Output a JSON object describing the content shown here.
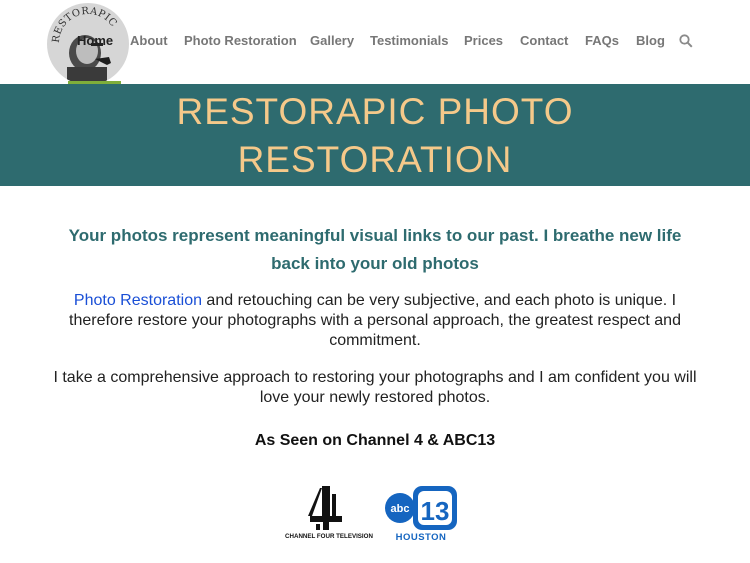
{
  "header": {
    "logo_text": "RESTORAPIC",
    "nav": [
      {
        "label": "Home",
        "active": true
      },
      {
        "label": "About"
      },
      {
        "label": "Photo Restoration"
      },
      {
        "label": "Gallery"
      },
      {
        "label": "Testimonials"
      },
      {
        "label": "Prices"
      },
      {
        "label": "Contact"
      },
      {
        "label": "FAQs"
      },
      {
        "label": "Blog"
      }
    ],
    "search_icon": "search-icon"
  },
  "banner": {
    "title_line1": "RESTORAPIC PHOTO",
    "title_line2": "RESTORATION"
  },
  "content": {
    "tagline_line1": "Your photos represent meaningful visual links to our past. I breathe new life",
    "tagline_line2": "back into your old photos",
    "para1_link": "Photo Restoration",
    "para1_rest": " and retouching can be very subjective, and each photo is unique. I therefore restore your photographs with a personal approach, the greatest respect and commitment.",
    "para2": "I take a comprehensive approach to restoring your photographs and I am confident you will love your newly restored photos.",
    "seen_on": "As Seen on Channel 4 & ABC13"
  },
  "media_logos": {
    "channel4_caption": "CHANNEL FOUR TELEVISION",
    "abc_text": "abc",
    "abc_number": "13",
    "abc_city": "HOUSTON"
  },
  "colors": {
    "banner": "#2e6b6f",
    "banner_text": "#f5c98a",
    "link": "#1a4fd6",
    "abc_blue": "#1565c0"
  }
}
